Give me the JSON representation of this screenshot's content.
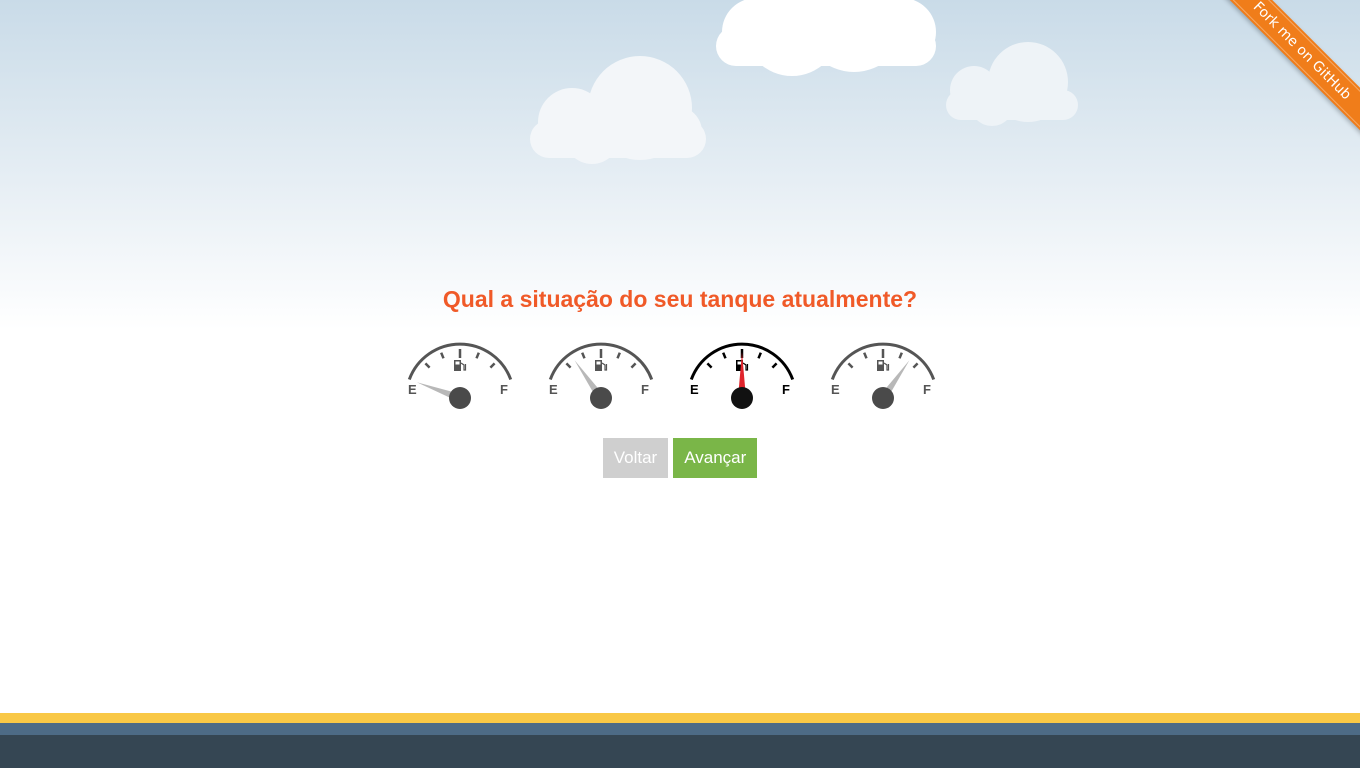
{
  "ribbon": {
    "label": "Fork me on GitHub",
    "color": "#f07d1a"
  },
  "question": {
    "text": "Qual a situação do seu tanque atualmente?",
    "color": "#f05a28"
  },
  "gauges": [
    {
      "empty_label": "E",
      "full_label": "F",
      "icon": "fuel-pump-icon",
      "level": 0.0,
      "selected": false
    },
    {
      "empty_label": "E",
      "full_label": "F",
      "icon": "fuel-pump-icon",
      "level": 0.25,
      "selected": false
    },
    {
      "empty_label": "E",
      "full_label": "F",
      "icon": "fuel-pump-icon",
      "level": 0.5,
      "selected": true
    },
    {
      "empty_label": "E",
      "full_label": "F",
      "icon": "fuel-pump-icon",
      "level": 0.75,
      "selected": false
    }
  ],
  "buttons": {
    "back_label": "Voltar",
    "next_label": "Avançar"
  },
  "colors": {
    "gauge_default": "#555555",
    "gauge_selected": "#000000",
    "needle_default": "#b8b8b8",
    "needle_selected": "#e0242c",
    "footer_yellow": "#f9c846",
    "footer_blue": "#4d6b86",
    "footer_dark": "#354653"
  }
}
